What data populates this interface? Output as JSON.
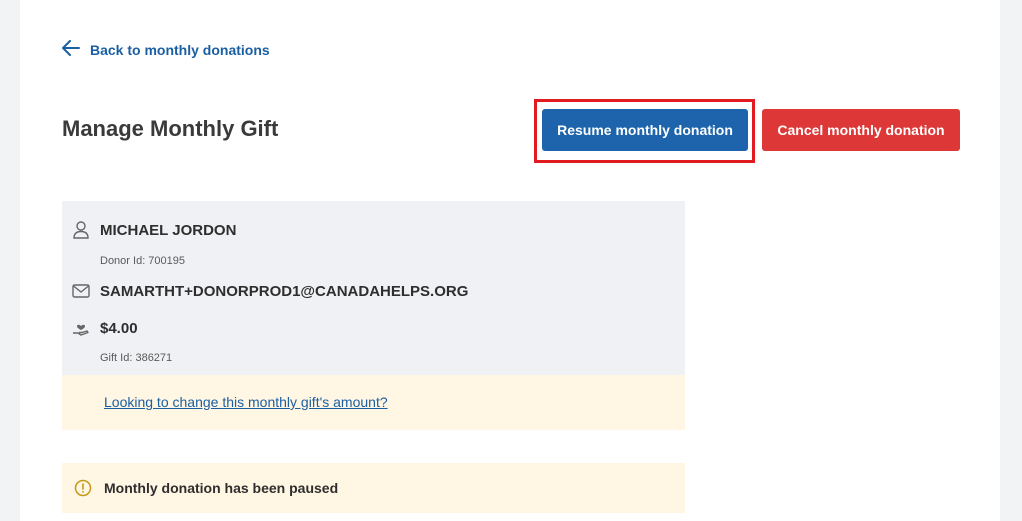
{
  "nav": {
    "back_label": "Back to monthly donations"
  },
  "page": {
    "title": "Manage Monthly Gift"
  },
  "actions": {
    "resume_label": "Resume monthly donation",
    "cancel_label": "Cancel monthly donation",
    "resume_color": "#1d64ac",
    "cancel_color": "#dd3737",
    "highlight_color": "#e21b23"
  },
  "donor": {
    "name": "MICHAEL JORDON",
    "donor_id": "Donor Id: 700195",
    "email": "SAMARTHT+DONORPROD1@CANADAHELPS.ORG",
    "amount": "$4.00",
    "gift_id": "Gift Id: 386271"
  },
  "change_link": "Looking to change this monthly gift's amount?",
  "status": {
    "message": "Monthly donation has been paused"
  },
  "icons": [
    "arrow-left-icon",
    "user-icon",
    "envelope-icon",
    "donation-hand-icon",
    "warning-circle-icon"
  ]
}
